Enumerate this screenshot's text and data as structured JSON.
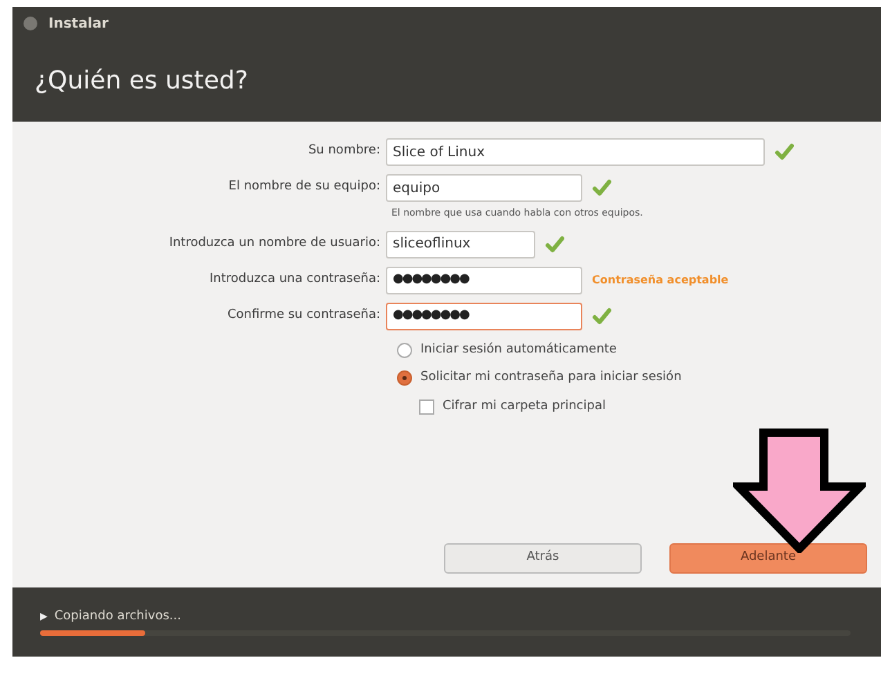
{
  "window": {
    "title": "Instalar"
  },
  "heading": "¿Quién es usted?",
  "fields": [
    {
      "label": "Su nombre:",
      "value": "Slice of Linux",
      "kind": "text",
      "valid": true,
      "focused": false
    },
    {
      "label": "El nombre de su equipo:",
      "value": "equipo",
      "kind": "text",
      "valid": true,
      "focused": false,
      "hint": "El nombre que usa cuando habla con otros equipos."
    },
    {
      "label": "Introduzca un nombre de usuario:",
      "value": "sliceoflinux",
      "kind": "text",
      "valid": true,
      "focused": false
    },
    {
      "label": "Introduzca una contraseña:",
      "value": "●●●●●●●●",
      "kind": "password",
      "message": "Contraseña aceptable",
      "focused": false
    },
    {
      "label": "Confirme su contraseña:",
      "value": "●●●●●●●●",
      "kind": "password",
      "valid": true,
      "focused": true
    }
  ],
  "login_options": [
    {
      "label": "Iniciar sesión automáticamente",
      "selected": false
    },
    {
      "label": "Solicitar mi contraseña para iniciar sesión",
      "selected": true
    }
  ],
  "encrypt": {
    "label": "Cifrar mi carpeta principal",
    "checked": false
  },
  "buttons": [
    {
      "label": "Atrás",
      "primary": false
    },
    {
      "label": "Adelante",
      "primary": true
    }
  ],
  "status": {
    "expander": "▶",
    "label": "Copiando archivos...",
    "expanded": false,
    "level": 0.13
  }
}
